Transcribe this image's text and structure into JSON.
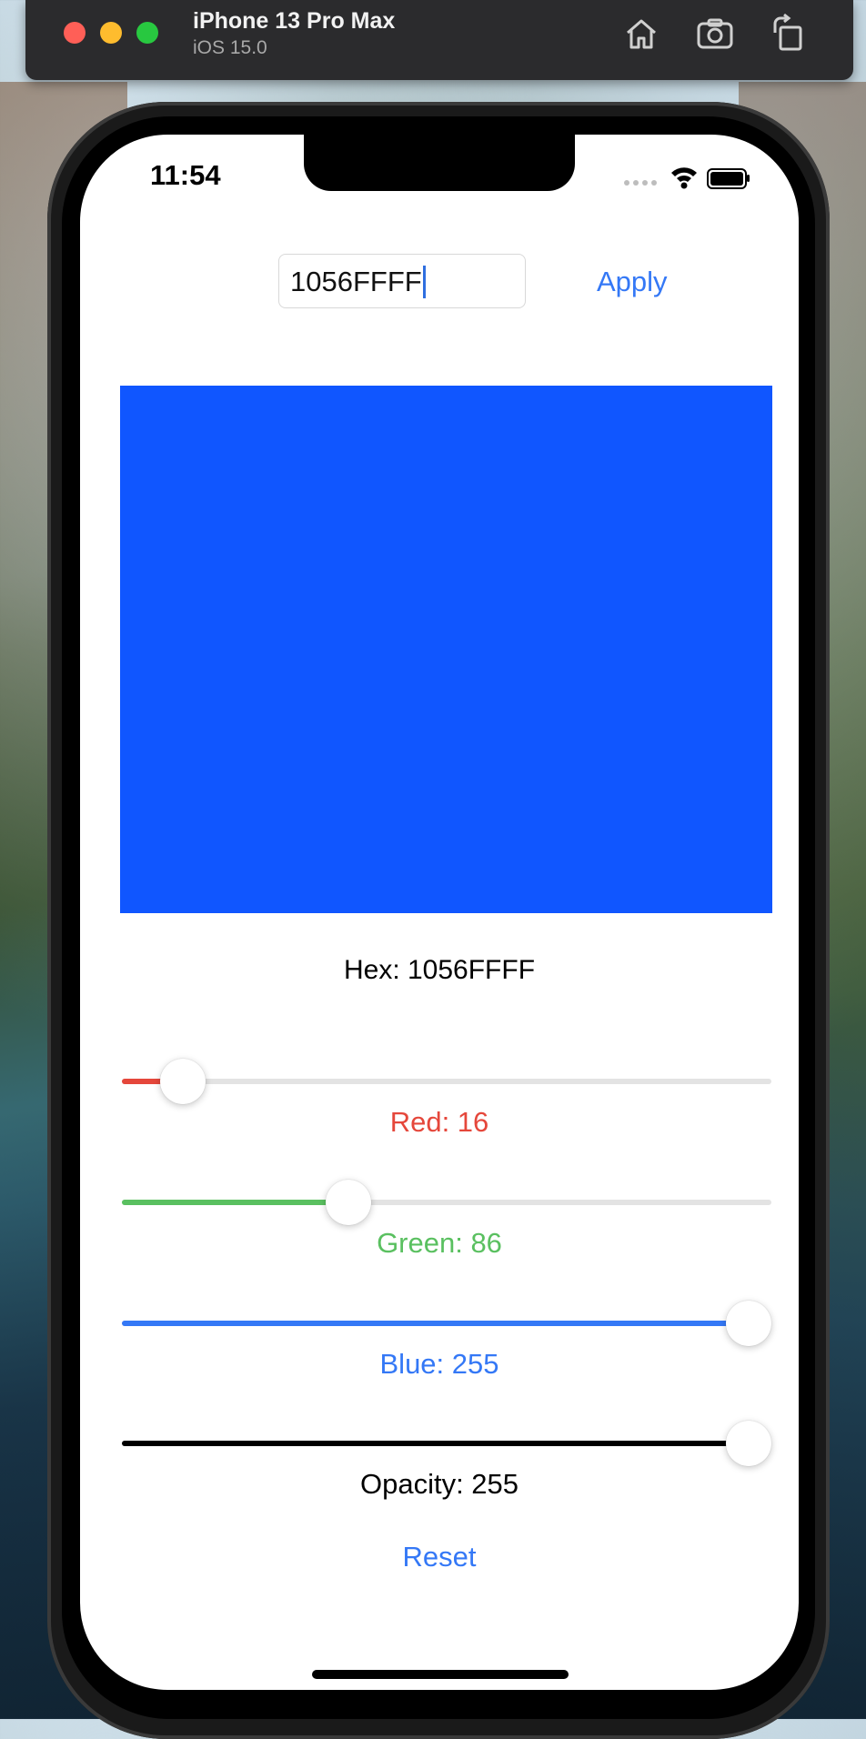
{
  "simulator": {
    "device_name": "iPhone 13 Pro Max",
    "os_version": "iOS 15.0",
    "icons": [
      "home-icon",
      "screenshot-icon",
      "rotate-icon"
    ]
  },
  "status_bar": {
    "time": "11:54",
    "icons": [
      "cellular-icon",
      "wifi-icon",
      "battery-icon"
    ]
  },
  "hex_input": {
    "value": "1056FFFF"
  },
  "apply_label": "Apply",
  "preview_color": "#1056FF",
  "hex_label": "Hex: 1056FFFF",
  "sliders": [
    {
      "key": "red",
      "label": "Red: 16",
      "value": 16,
      "max": 255,
      "color": "#e5473b"
    },
    {
      "key": "green",
      "label": "Green: 86",
      "value": 86,
      "max": 255,
      "color": "#5ac060"
    },
    {
      "key": "blue",
      "label": "Blue: 255",
      "value": 255,
      "max": 255,
      "color": "#3478f6"
    },
    {
      "key": "opacity",
      "label": "Opacity: 255",
      "value": 255,
      "max": 255,
      "color": "#000000"
    }
  ],
  "reset_label": "Reset"
}
